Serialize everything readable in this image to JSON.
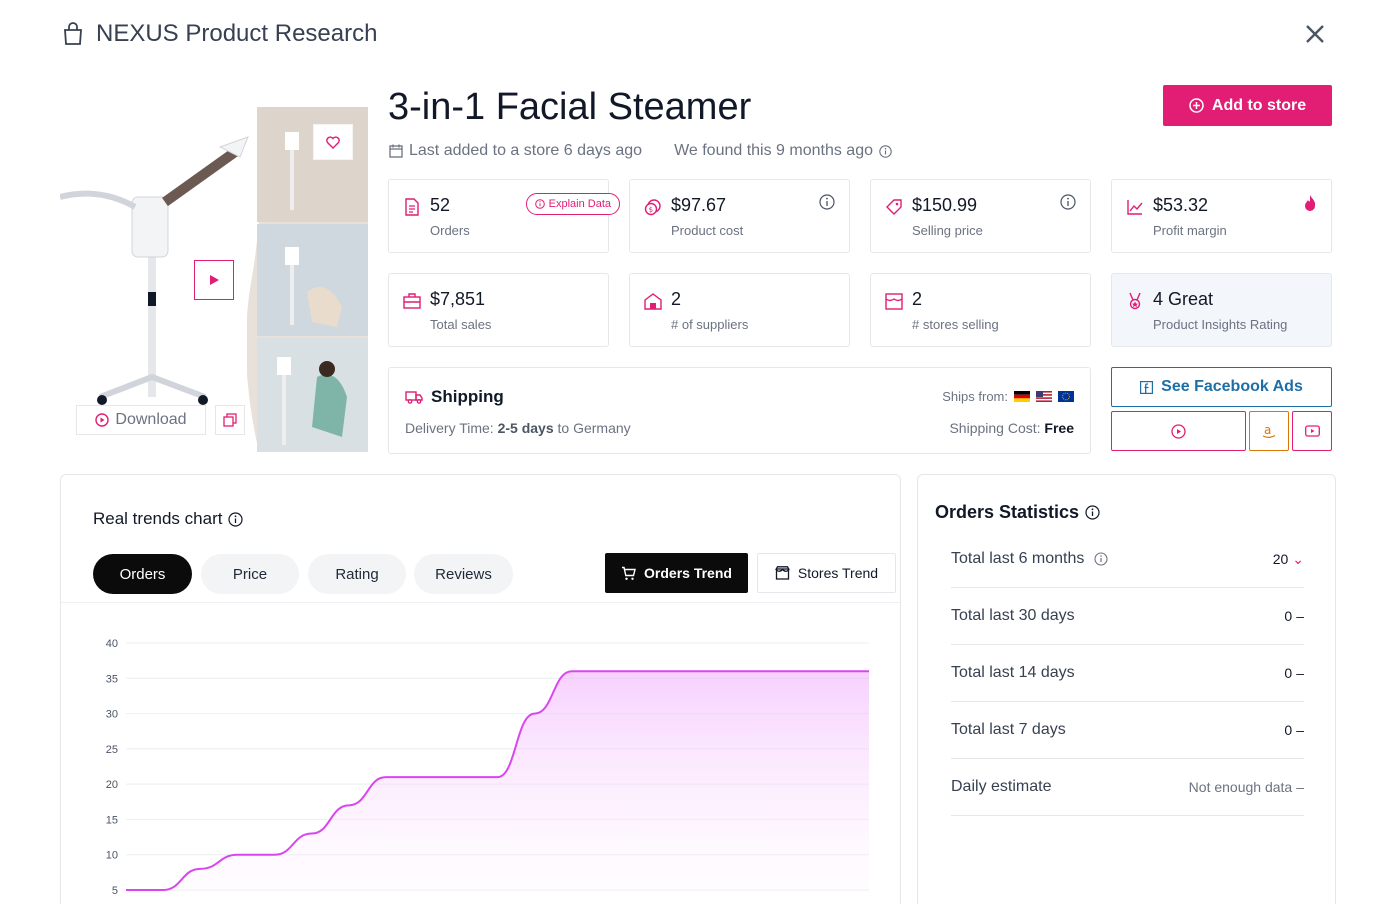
{
  "header": {
    "title": "NEXUS Product Research"
  },
  "product": {
    "title": "3-in-1 Facial Steamer",
    "last_added": "Last added to a store 6 days ago",
    "found": "We found this 9 months ago"
  },
  "actions": {
    "add_to_store": "Add to store",
    "download": "Download",
    "facebook_ads": "See Facebook Ads"
  },
  "stats": [
    {
      "value": "52",
      "label": "Orders",
      "icon": "document-icon",
      "extra": "Explain Data"
    },
    {
      "value": "$97.67",
      "label": "Product cost",
      "icon": "coins-icon"
    },
    {
      "value": "$150.99",
      "label": "Selling price",
      "icon": "tag-icon"
    },
    {
      "value": "$53.32",
      "label": "Profit margin",
      "icon": "chart-line-icon"
    },
    {
      "value": "$7,851",
      "label": "Total sales",
      "icon": "briefcase-icon"
    },
    {
      "value": "2",
      "label": "# of suppliers",
      "icon": "warehouse-icon"
    },
    {
      "value": "2",
      "label": "# stores selling",
      "icon": "store-icon"
    },
    {
      "value": "4 Great",
      "label": "Product Insights Rating",
      "icon": "award-icon"
    }
  ],
  "shipping": {
    "title": "Shipping",
    "delivery_label": "Delivery Time:",
    "delivery_value": "2-5 days",
    "delivery_to": "to Germany",
    "ships_from_label": "Ships from:",
    "cost_label": "Shipping Cost:",
    "cost_value": "Free",
    "flags": [
      "Germany",
      "United States",
      "European Union"
    ]
  },
  "trends": {
    "title": "Real trends chart",
    "tabs": [
      "Orders",
      "Price",
      "Rating",
      "Reviews"
    ],
    "active_tab": "Orders",
    "buttons": {
      "orders_trend": "Orders Trend",
      "stores_trend": "Stores Trend"
    }
  },
  "chart_data": {
    "type": "area",
    "title": "",
    "xlabel": "",
    "ylabel": "",
    "ylim": [
      5,
      40
    ],
    "yticks": [
      40,
      35,
      30,
      25,
      20,
      15,
      10,
      5
    ],
    "x": [
      0,
      1,
      2,
      3,
      4,
      5,
      6,
      7,
      8,
      9,
      10,
      11,
      12,
      13,
      14,
      15,
      16,
      17,
      18,
      19,
      20
    ],
    "series": [
      {
        "values": [
          5,
          5,
          8,
          10,
          10,
          13,
          17,
          21,
          21,
          21,
          21,
          30,
          36,
          36,
          36,
          36,
          36,
          36,
          36,
          36,
          36
        ]
      }
    ],
    "colors": {
      "line": "#d946ef",
      "fill_top": "#f0abfc",
      "fill_bottom": "#fdf4ff"
    }
  },
  "orders_stats": {
    "title": "Orders Statistics",
    "rows": [
      {
        "label": "Total last 6 months",
        "value": "20",
        "indicator": "⌄"
      },
      {
        "label": "Total last 30 days",
        "value": "0",
        "indicator": "–"
      },
      {
        "label": "Total last 14 days",
        "value": "0",
        "indicator": "–"
      },
      {
        "label": "Total last 7 days",
        "value": "0",
        "indicator": "–"
      },
      {
        "label": "Daily estimate",
        "value": "Not enough data",
        "indicator": "–"
      }
    ]
  },
  "colors": {
    "accent": "#e11d74",
    "facebook": "#1e6fa8"
  }
}
